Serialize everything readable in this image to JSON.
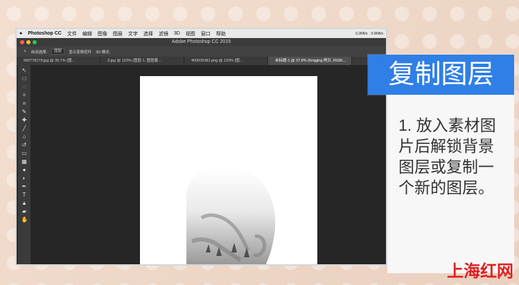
{
  "menubar": {
    "app": "Photoshop CC",
    "items": [
      "文件",
      "编辑",
      "图像",
      "图层",
      "文字",
      "选择",
      "滤镜",
      "3D",
      "视图",
      "窗口",
      "帮助"
    ],
    "status_top": "0.2KB/s",
    "status_bottom": "0.0KB/s"
  },
  "window": {
    "title": "Adobe Photoshop CC 2015"
  },
  "options": {
    "auto_select": "自动选择:",
    "layer": "图层",
    "show_controls": "显示变换控件",
    "mode_3d": "3D 模式:"
  },
  "tabs": [
    "500778179.jpg @ 35.7% (图...",
    "3.jpg @ 123% (图层 1, 图层蒙...",
    "400505381.png @ 133% (图...",
    "未标题-1 @ 37.8% (fengjing 拷贝, RGB/..."
  ],
  "tools": [
    "move-tool",
    "marquee-tool",
    "lasso-tool",
    "magic-wand-tool",
    "crop-tool",
    "eyedropper-tool",
    "healing-tool",
    "brush-tool",
    "clone-tool",
    "history-brush-tool",
    "eraser-tool",
    "gradient-tool",
    "blur-tool",
    "dodge-tool",
    "pen-tool",
    "type-tool",
    "path-selection-tool",
    "shape-tool",
    "hand-tool",
    "zoom-tool"
  ],
  "banner": {
    "title": "复制图层"
  },
  "description": {
    "text": "1. 放入素材图片后解锁背景图层或复制一个新的图层。"
  },
  "watermark": {
    "text": "上海红网"
  },
  "colors": {
    "accent": "#2f7fe6",
    "watermark": "#e02020"
  }
}
